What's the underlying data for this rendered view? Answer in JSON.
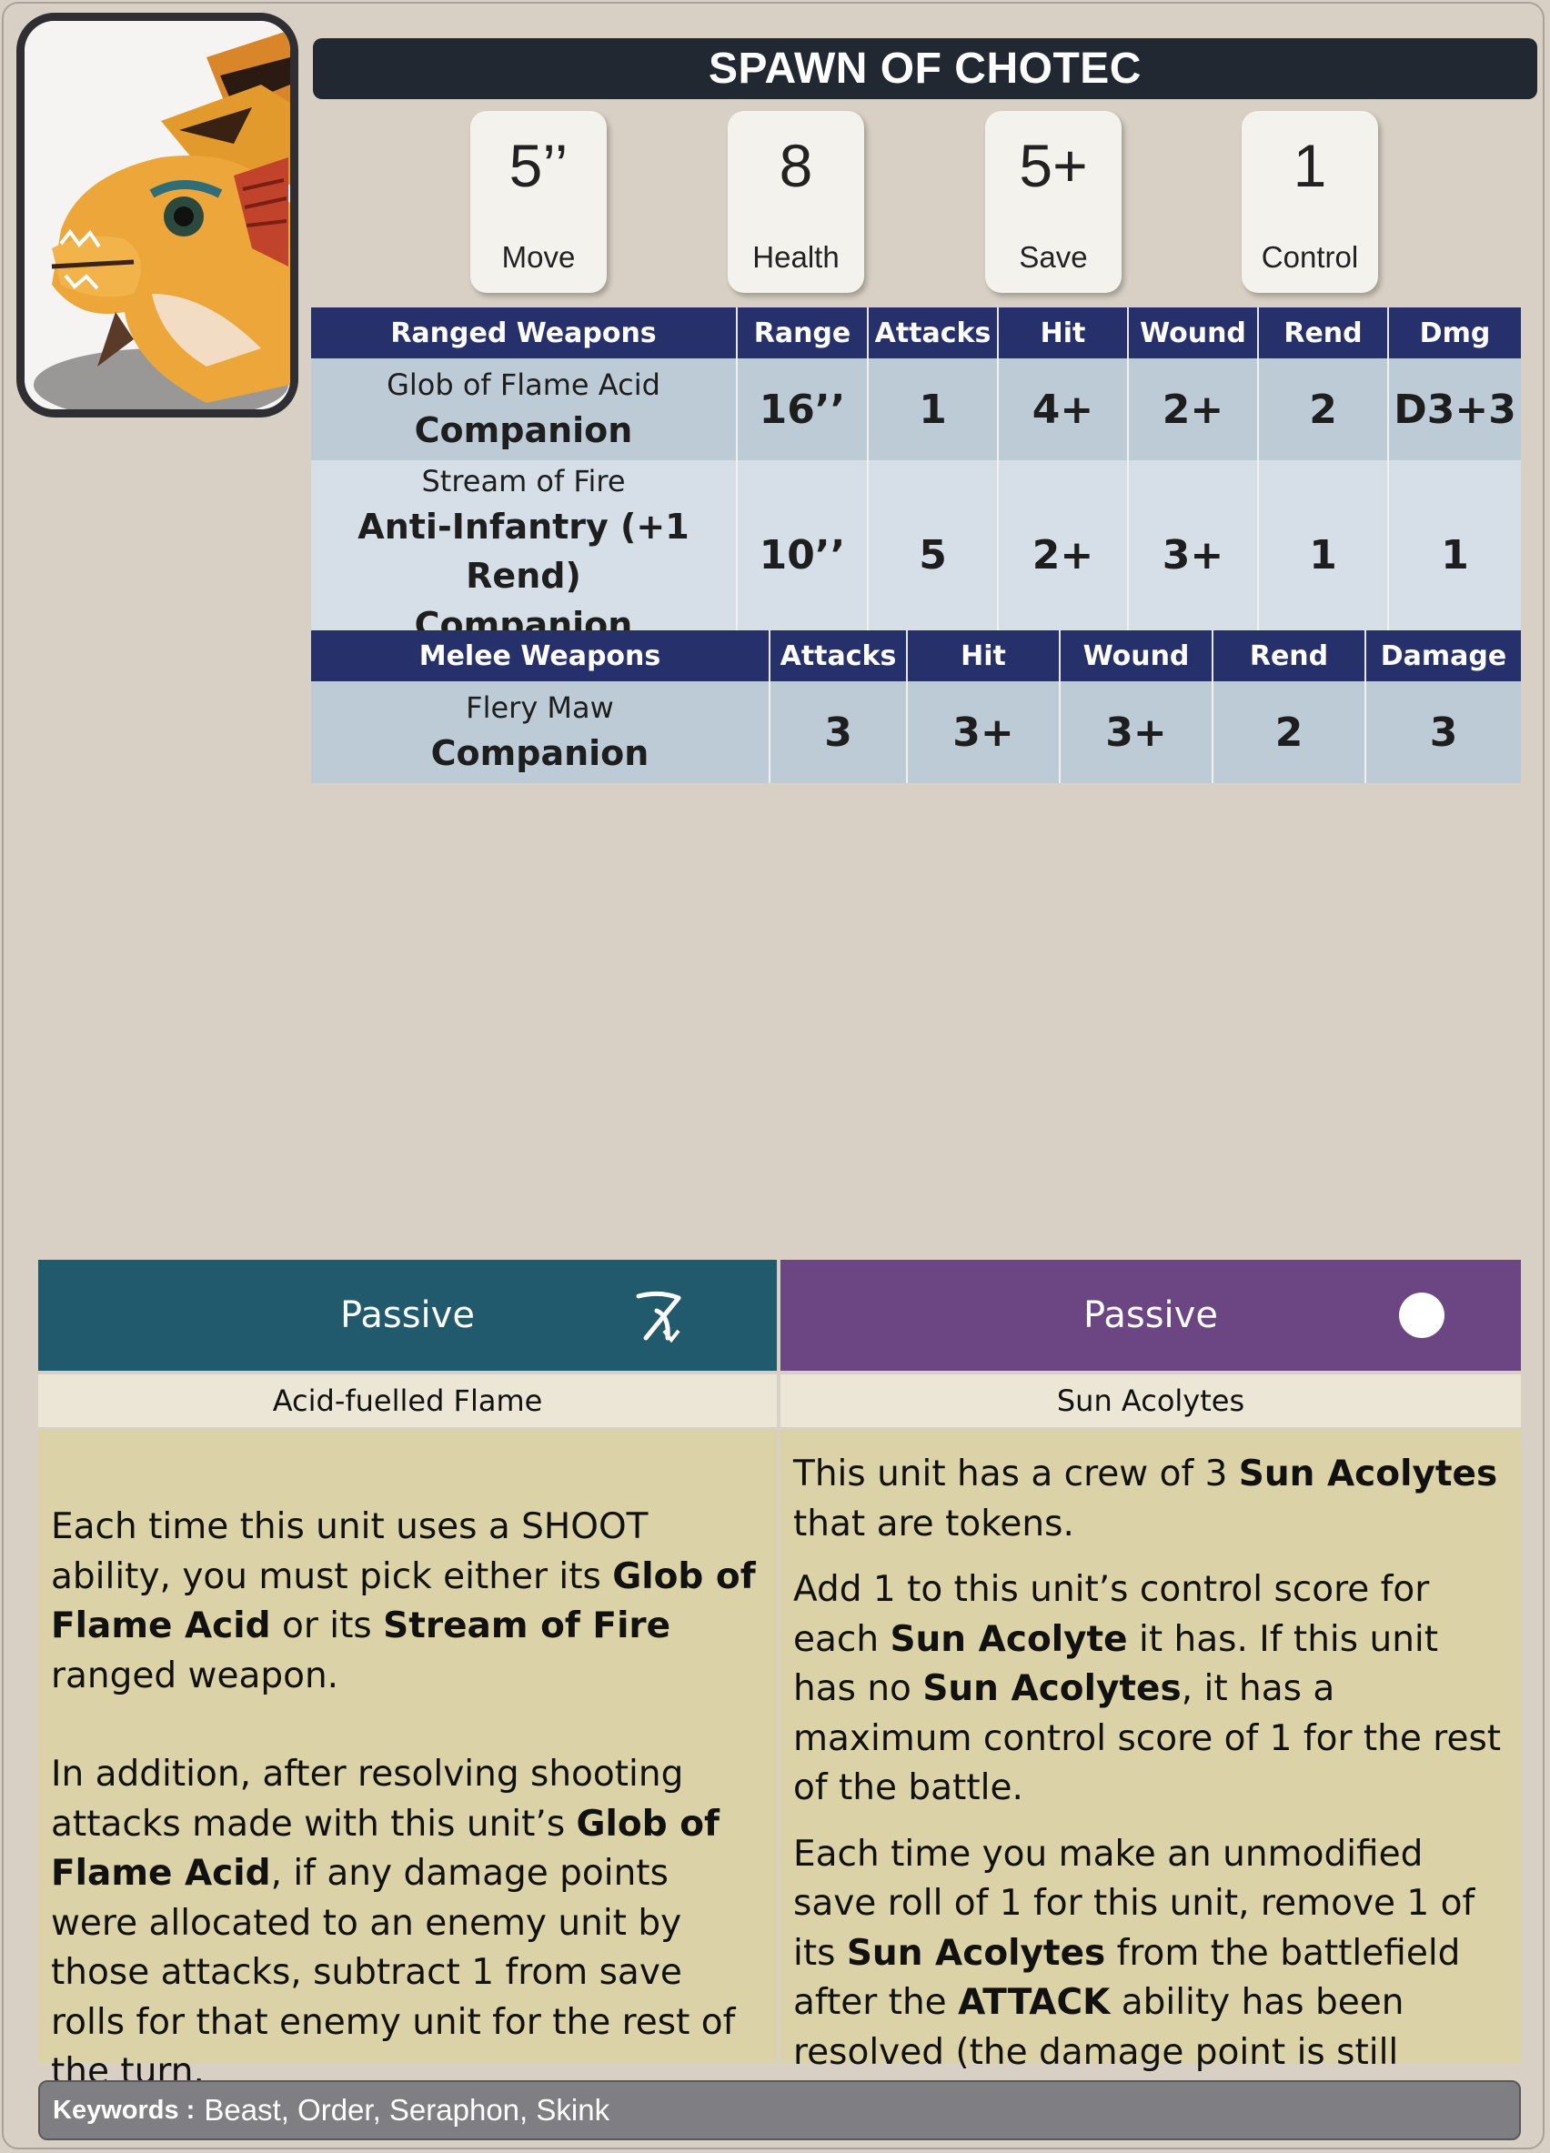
{
  "unit_name": "SPAWN OF CHOTEC",
  "stats": [
    {
      "value": "5’’",
      "label": "Move"
    },
    {
      "value": "8",
      "label": "Health"
    },
    {
      "value": "5+",
      "label": "Save"
    },
    {
      "value": "1",
      "label": "Control"
    }
  ],
  "ranged": {
    "headers": [
      "Ranged Weapons",
      "Range",
      "Attacks",
      "Hit",
      "Wound",
      "Rend",
      "Dmg"
    ],
    "rows": [
      {
        "name": "Glob of Flame Acid",
        "keywords": [
          "Companion"
        ],
        "range": "16’’",
        "attacks": "1",
        "hit": "4+",
        "wound": "2+",
        "rend": "2",
        "damage": "D3+3"
      },
      {
        "name": "Stream of Fire",
        "keywords": [
          "Anti-Infantry (+1 Rend)",
          "Companion"
        ],
        "range": "10’’",
        "attacks": "5",
        "hit": "2+",
        "wound": "3+",
        "rend": "1",
        "damage": "1"
      }
    ]
  },
  "melee": {
    "headers": [
      "Melee Weapons",
      "Attacks",
      "Hit",
      "Wound",
      "Rend",
      "Damage"
    ],
    "rows": [
      {
        "name": "Flery Maw",
        "keywords": [
          "Companion"
        ],
        "attacks": "3",
        "hit": "3+",
        "wound": "3+",
        "rend": "2",
        "damage": "3"
      }
    ]
  },
  "abilities": [
    {
      "timing": "Passive",
      "icon": "bow-icon",
      "header_color": "#215a6d",
      "name": "Acid-fuelled Flame",
      "paragraphs": [
        [
          {
            "t": "Each time this unit uses a SHOOT ability, you must pick either its "
          },
          {
            "t": "Glob of Flame Acid",
            "b": true
          },
          {
            "t": " or its "
          },
          {
            "t": "Stream of Fire",
            "b": true
          },
          {
            "t": " ranged weapon."
          }
        ],
        [
          {
            "t": "In addition, after resolving shooting attacks made with this unit’s "
          },
          {
            "t": "Glob of Flame Acid",
            "b": true
          },
          {
            "t": ", if any damage points were allocated to an enemy unit by those attacks, subtract 1 from save rolls for that enemy unit for the rest of the turn."
          }
        ]
      ]
    },
    {
      "timing": "Passive",
      "icon": "circle-icon",
      "header_color": "#6b4683",
      "name": "Sun Acolytes",
      "paragraphs": [
        [
          {
            "t": "This unit has a crew of 3 "
          },
          {
            "t": "Sun Acolytes",
            "b": true
          },
          {
            "t": " that are tokens."
          }
        ],
        [
          {
            "t": "Add 1 to this unit’s control score for each "
          },
          {
            "t": "Sun Acolyte",
            "b": true
          },
          {
            "t": " it has. If this unit has no "
          },
          {
            "t": "Sun Acolytes",
            "b": true
          },
          {
            "t": ", it has a maximum control score of 1 for the rest of the battle."
          }
        ],
        [
          {
            "t": "Each time you make an unmodified save roll of 1 for this unit, remove 1 of its "
          },
          {
            "t": "Sun Acolytes",
            "b": true
          },
          {
            "t": " from the battlefield after the "
          },
          {
            "t": "ATTACK",
            "b": true
          },
          {
            "t": " ability has been resolved (the damage point is still inflicted)."
          }
        ]
      ]
    }
  ],
  "keywords_label": "Keywords :",
  "keywords": "Beast, Order, Seraphon, Skink"
}
